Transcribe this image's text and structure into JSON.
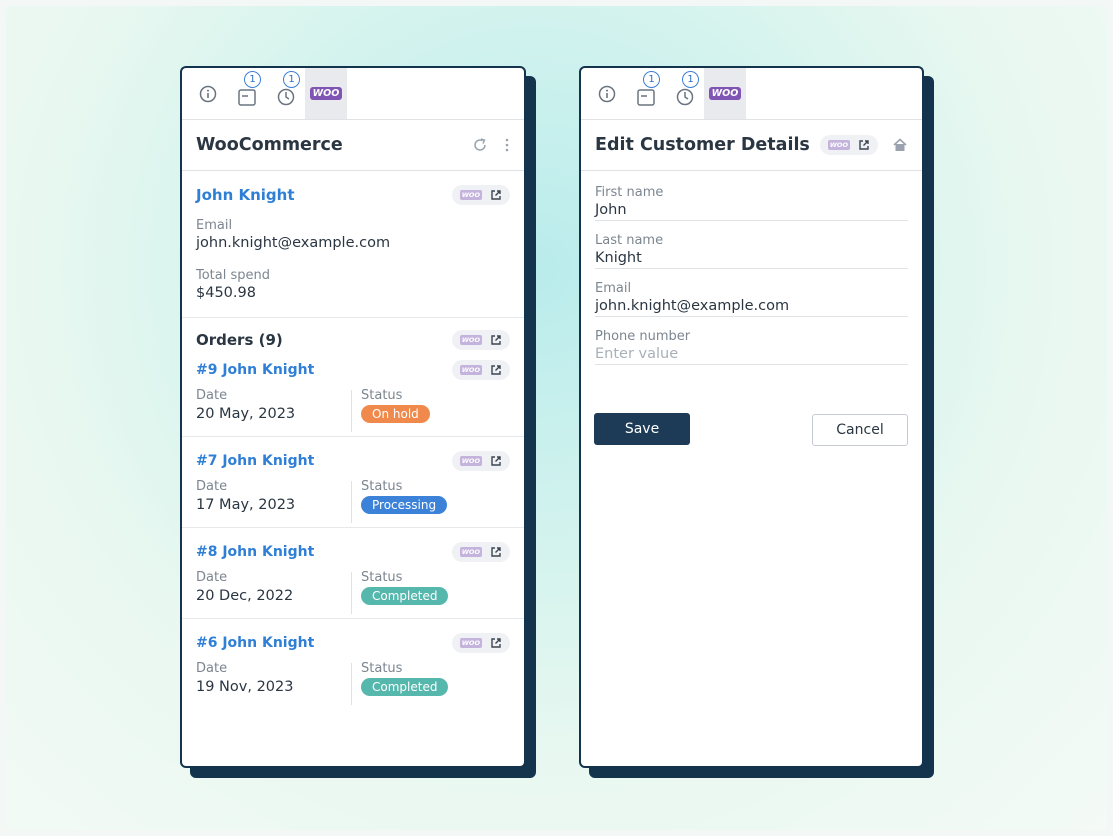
{
  "left_panel": {
    "tab_badges": {
      "tasks": "1",
      "history": "1"
    },
    "woo_tab_label": "WOO",
    "title": "WooCommerce",
    "customer": {
      "name": "John Knight",
      "email_label": "Email",
      "email": "john.knight@example.com",
      "spend_label": "Total spend",
      "spend": "$450.98"
    },
    "orders_heading": "Orders (9)",
    "orders": [
      {
        "title": "#9 John Knight",
        "date_label": "Date",
        "date": "20 May, 2023",
        "status_label": "Status",
        "status": "On hold",
        "status_color": "#ef8a4c"
      },
      {
        "title": "#7 John Knight",
        "date_label": "Date",
        "date": "17 May, 2023",
        "status_label": "Status",
        "status": "Processing",
        "status_color": "#3b82d8"
      },
      {
        "title": "#8 John Knight",
        "date_label": "Date",
        "date": "20 Dec, 2022",
        "status_label": "Status",
        "status": "Completed",
        "status_color": "#56b8ad"
      },
      {
        "title": "#6 John Knight",
        "date_label": "Date",
        "date": "19 Nov, 2023",
        "status_label": "Status",
        "status": "Completed",
        "status_color": "#56b8ad"
      }
    ]
  },
  "right_panel": {
    "tab_badges": {
      "tasks": "1",
      "history": "1"
    },
    "woo_tab_label": "WOO",
    "title": "Edit Customer Details",
    "fields": [
      {
        "label": "First name",
        "value": "John",
        "placeholder": ""
      },
      {
        "label": "Last name",
        "value": "Knight",
        "placeholder": ""
      },
      {
        "label": "Email",
        "value": "john.knight@example.com",
        "placeholder": ""
      },
      {
        "label": "Phone number",
        "value": "",
        "placeholder": "Enter value"
      }
    ],
    "save_label": "Save",
    "cancel_label": "Cancel"
  },
  "colors": {
    "brand_dark": "#14344e",
    "link_blue": "#2f7fd6",
    "woo_purple": "#7f54b3"
  },
  "icons": [
    "info-icon",
    "tasks-icon",
    "history-icon",
    "woo-icon",
    "refresh-icon",
    "more-vertical-icon",
    "external-link-icon",
    "home-icon"
  ]
}
